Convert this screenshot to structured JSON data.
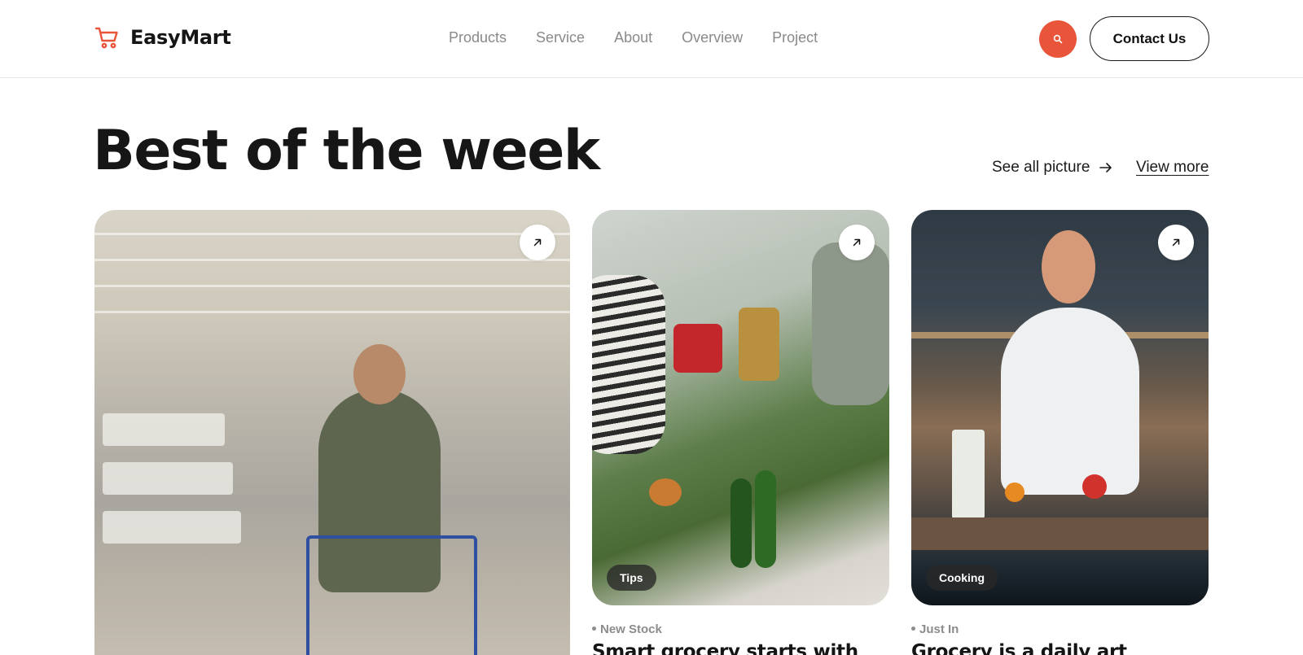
{
  "header": {
    "brand": "EasyMart",
    "nav": [
      "Products",
      "Service",
      "About",
      "Overview",
      "Project"
    ],
    "contact_label": "Contact Us"
  },
  "section": {
    "title": "Best of the week",
    "see_all_label": "See all picture",
    "view_more_label": "View more"
  },
  "cards": [
    {
      "tag": "",
      "meta": "",
      "title": ""
    },
    {
      "tag": "Tips",
      "meta": "New Stock",
      "title": "Smart grocery starts with"
    },
    {
      "tag": "Cooking",
      "meta": "Just In",
      "title": "Grocery is a daily art"
    }
  ],
  "colors": {
    "accent": "#e9553a",
    "text": "#151515",
    "muted": "#8a8a8a"
  },
  "icons": [
    "cart-icon",
    "search-icon",
    "arrow-right-icon",
    "arrow-up-right-icon"
  ]
}
